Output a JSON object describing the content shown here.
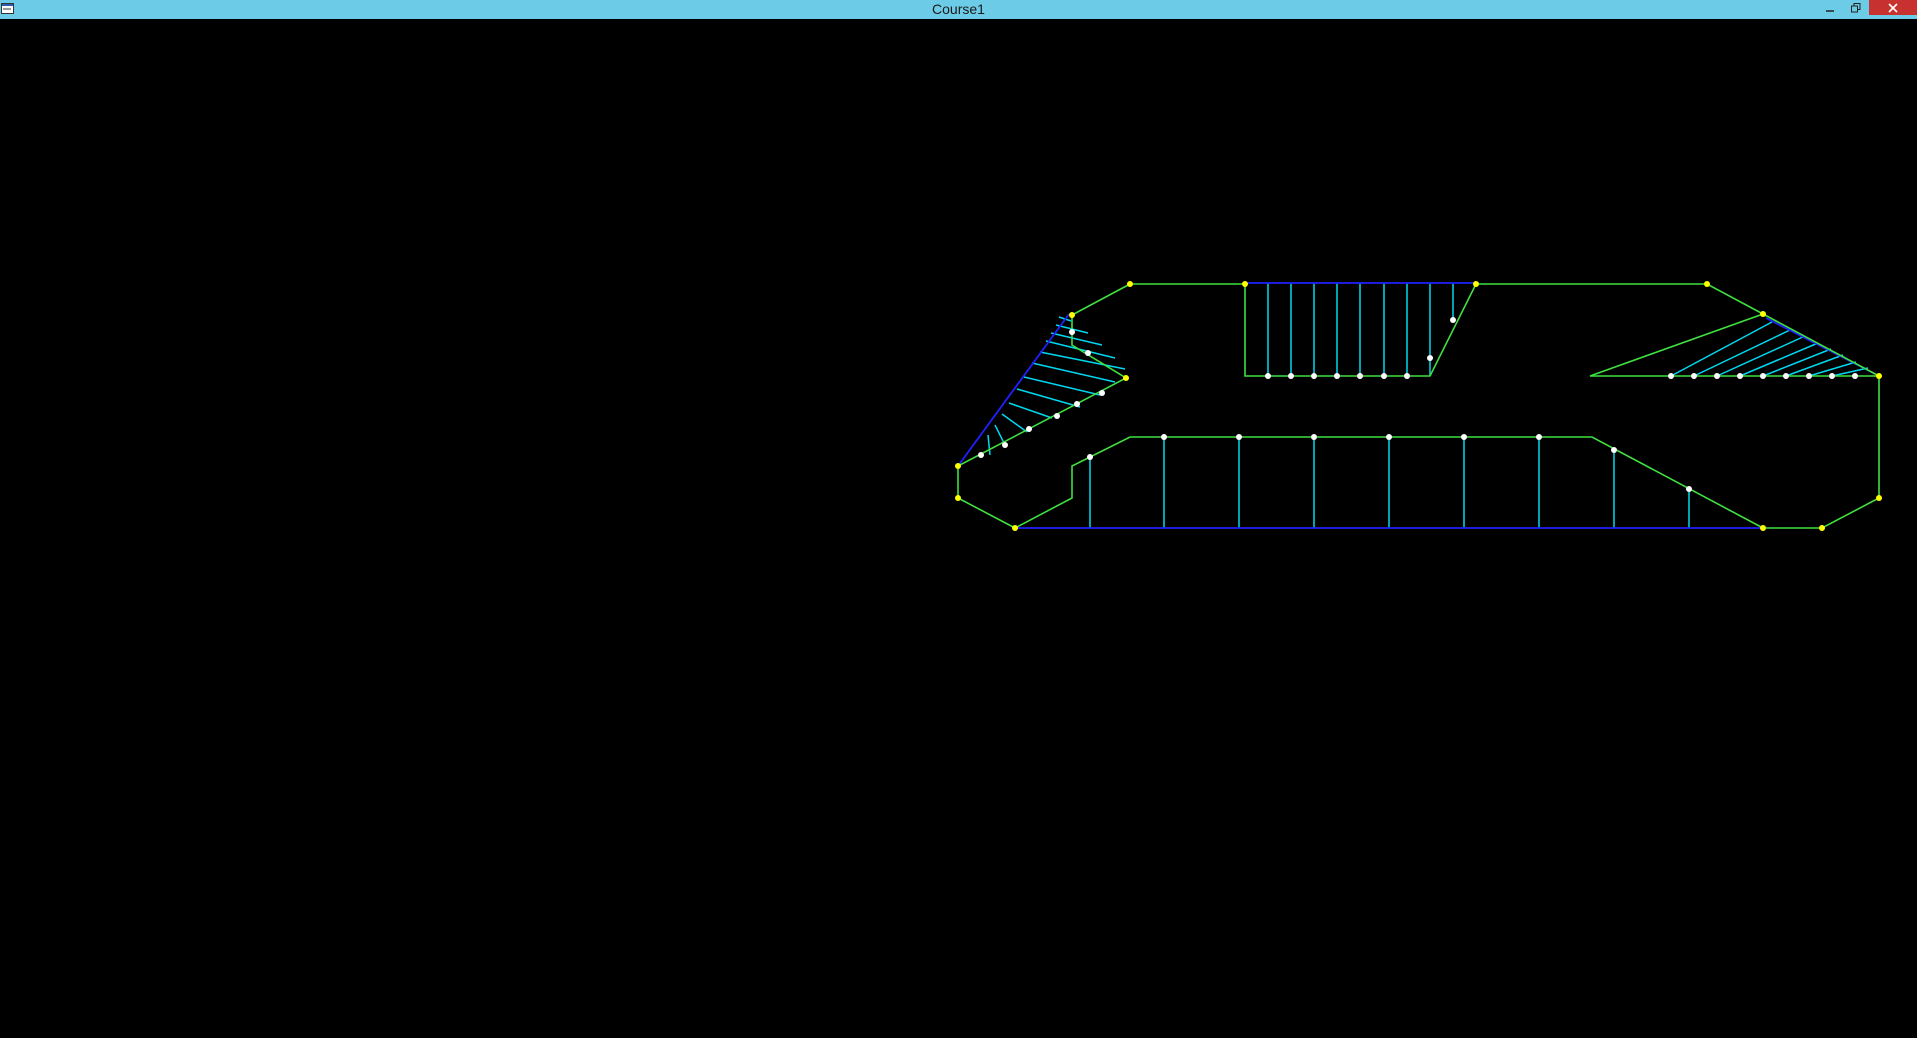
{
  "window": {
    "title": "Course1",
    "icon": "app-window-icon",
    "controls": [
      "minimize-icon",
      "restore-icon",
      "close-icon"
    ]
  },
  "colors": {
    "titlebar": "#6ccbe6",
    "background": "#000000",
    "outline": "#3fe03f",
    "fill_edge": "#2020ff",
    "hatch": "#00d8f0",
    "vertex": "#ffff00",
    "sample_point": "#ffffff"
  }
}
